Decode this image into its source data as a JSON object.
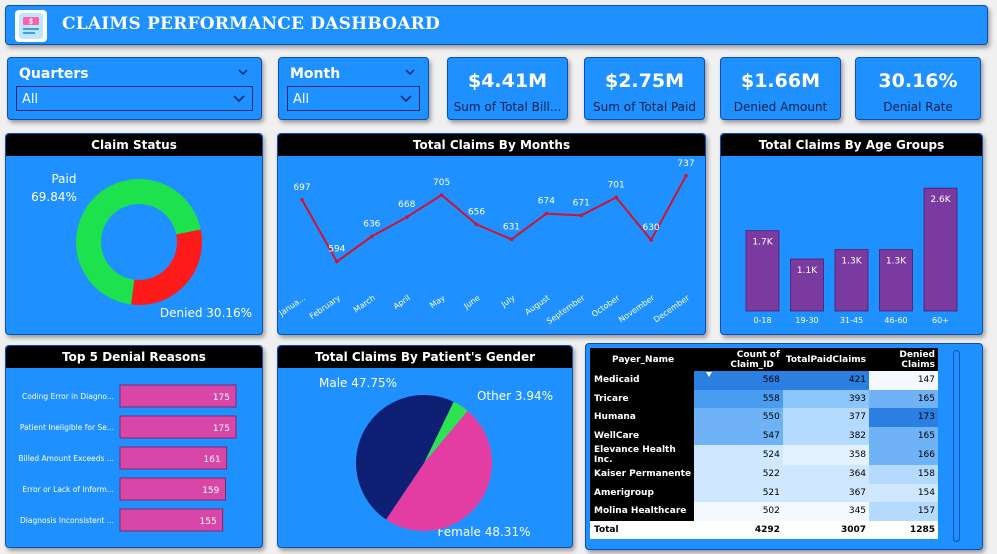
{
  "header": {
    "title": "CLAIMS PERFORMANCE DASHBOARD"
  },
  "slicers": {
    "quarters": {
      "label": "Quarters",
      "value": "All"
    },
    "month": {
      "label": "Month",
      "value": "All"
    }
  },
  "kpis": [
    {
      "value": "$4.41M",
      "label": "Sum of Total Bill..."
    },
    {
      "value": "$2.75M",
      "label": "Sum of Total Paid"
    },
    {
      "value": "$1.66M",
      "label": "Denied Amount"
    },
    {
      "value": "30.16%",
      "label": "Denial Rate"
    }
  ],
  "colors": {
    "panel": "#1e90ff",
    "paid": "#1ee14e",
    "denied": "#ff1a1a",
    "line": "#d2122e",
    "age_bar": "#7b3aa0",
    "reason_bar": "#d846a7",
    "male": "#0f1f73",
    "female": "#e33da4",
    "other": "#2ee351"
  },
  "charts": {
    "claim_status": {
      "title": "Claim Status",
      "chart_data": {
        "type": "pie",
        "donut": true,
        "categories": [
          "Paid",
          "Denied"
        ],
        "values": [
          69.84,
          30.16
        ]
      },
      "labels": {
        "paid_name": "Paid",
        "paid_pct": "69.84%",
        "denied": "Denied 30.16%"
      }
    },
    "by_months": {
      "title": "Total Claims By Months",
      "chart_data": {
        "type": "line",
        "x": [
          "Janua...",
          "February",
          "March",
          "April",
          "May",
          "June",
          "July",
          "August",
          "September",
          "October",
          "November",
          "December"
        ],
        "values": [
          697,
          594,
          636,
          668,
          705,
          656,
          631,
          674,
          671,
          701,
          630,
          737
        ],
        "ylim": [
          590,
          740
        ]
      }
    },
    "age_groups": {
      "title": "Total Claims By Age Groups",
      "chart_data": {
        "type": "bar",
        "categories": [
          "0-18",
          "19-30",
          "31-45",
          "46-60",
          "60+"
        ],
        "values": [
          1700,
          1100,
          1300,
          1300,
          2600
        ],
        "value_labels": [
          "1.7K",
          "1.1K",
          "1.3K",
          "1.3K",
          "2.6K"
        ],
        "ylim": [
          0,
          2900
        ]
      }
    },
    "denial_reasons": {
      "title": "Top 5 Denial Reasons",
      "chart_data": {
        "type": "bar",
        "orientation": "horizontal",
        "categories": [
          "Coding Error in Diagno...",
          "Patient Ineligible for Se...",
          "Billed Amount Exceeds ...",
          "Error or Lack of Inform...",
          "Diagnosis Inconsistent ..."
        ],
        "values": [
          175,
          175,
          161,
          159,
          155
        ],
        "xlim": [
          0,
          175
        ]
      }
    },
    "gender": {
      "title": "Total Claims By Patient's Gender",
      "chart_data": {
        "type": "pie",
        "categories": [
          "Male",
          "Female",
          "Other"
        ],
        "values": [
          47.75,
          48.31,
          3.94
        ]
      },
      "labels": {
        "male": "Male 47.75%",
        "other": "Other 3.94%",
        "female": "Female 48.31%"
      }
    }
  },
  "table": {
    "columns": [
      "Payer_Name",
      "Count of Claim_ID",
      "TotalPaidClaims",
      "Denied Claims"
    ],
    "rows": [
      [
        "Medicaid",
        "568",
        "421",
        "147"
      ],
      [
        "Tricare",
        "558",
        "393",
        "165"
      ],
      [
        "Humana",
        "550",
        "377",
        "173"
      ],
      [
        "WellCare",
        "547",
        "382",
        "165"
      ],
      [
        "Elevance Health Inc.",
        "524",
        "358",
        "166"
      ],
      [
        "Kaiser Permanente",
        "522",
        "364",
        "158"
      ],
      [
        "Amerigroup",
        "521",
        "367",
        "154"
      ],
      [
        "Molina Healthcare",
        "502",
        "345",
        "157"
      ]
    ],
    "total": [
      "Total",
      "4292",
      "3007",
      "1285"
    ]
  }
}
